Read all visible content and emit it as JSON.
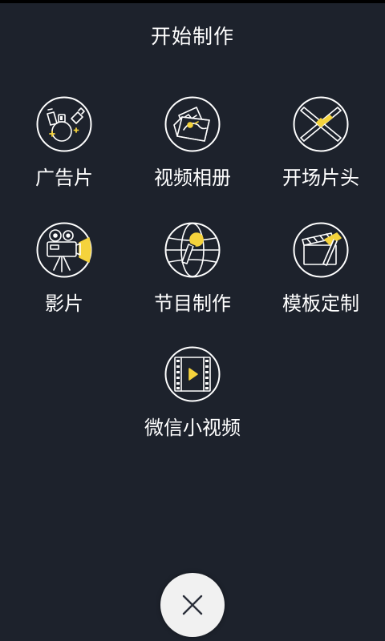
{
  "title": "开始制作",
  "accent_color": "#f5d33c",
  "items": [
    {
      "label": "广告片",
      "icon": "perfume-bottles-icon"
    },
    {
      "label": "视频相册",
      "icon": "photo-album-icon"
    },
    {
      "label": "开场片头",
      "icon": "crossed-sticks-icon"
    },
    {
      "label": "影片",
      "icon": "film-camera-icon"
    },
    {
      "label": "节目制作",
      "icon": "microphone-globe-icon"
    },
    {
      "label": "模板定制",
      "icon": "clapperboard-hammer-icon"
    },
    {
      "label": "微信小视频",
      "icon": "film-strip-play-icon"
    }
  ],
  "close_button": {
    "icon": "close-icon"
  }
}
